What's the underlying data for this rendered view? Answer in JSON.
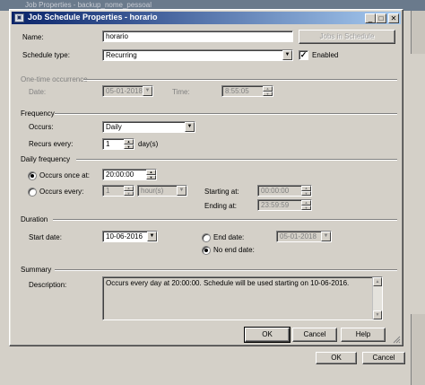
{
  "background_window": {
    "title": "Job Properties - backup_nome_pessoal",
    "ok_label": "OK",
    "cancel_label": "Cancel"
  },
  "dialog": {
    "title": "Job Schedule Properties - horario",
    "caption_buttons": {
      "minimize": "_",
      "maximize": "□",
      "close": "✕"
    },
    "name_label": "Name:",
    "name_value": "horario",
    "jobs_in_schedule_label": "Jobs in Schedule",
    "schedule_type_label": "Schedule type:",
    "schedule_type_value": "Recurring",
    "enabled_label": "Enabled",
    "enabled_checked": true,
    "one_time": {
      "header": "One-time occurrence",
      "date_label": "Date:",
      "date_value": "05-01-2018",
      "time_label": "Time:",
      "time_value": "8:55:05"
    },
    "frequency": {
      "header": "Frequency",
      "occurs_label": "Occurs:",
      "occurs_value": "Daily",
      "recurs_label": "Recurs every:",
      "recurs_value": "1",
      "recurs_unit": "day(s)"
    },
    "daily_frequency": {
      "header": "Daily frequency",
      "once_label": "Occurs once at:",
      "once_value": "20:00:00",
      "every_label": "Occurs every:",
      "every_value": "1",
      "every_unit": "hour(s)",
      "starting_label": "Starting at:",
      "starting_value": "00:00:00",
      "ending_label": "Ending at:",
      "ending_value": "23:59:59"
    },
    "duration": {
      "header": "Duration",
      "start_label": "Start date:",
      "start_value": "10-06-2016",
      "end_date_label": "End date:",
      "end_date_value": "05-01-2018",
      "no_end_label": "No end date:"
    },
    "summary": {
      "header": "Summary",
      "description_label": "Description:",
      "description_value": "Occurs every day at 20:00:00. Schedule will be used starting on 10-06-2016."
    },
    "buttons": {
      "ok": "OK",
      "cancel": "Cancel",
      "help": "Help"
    }
  }
}
